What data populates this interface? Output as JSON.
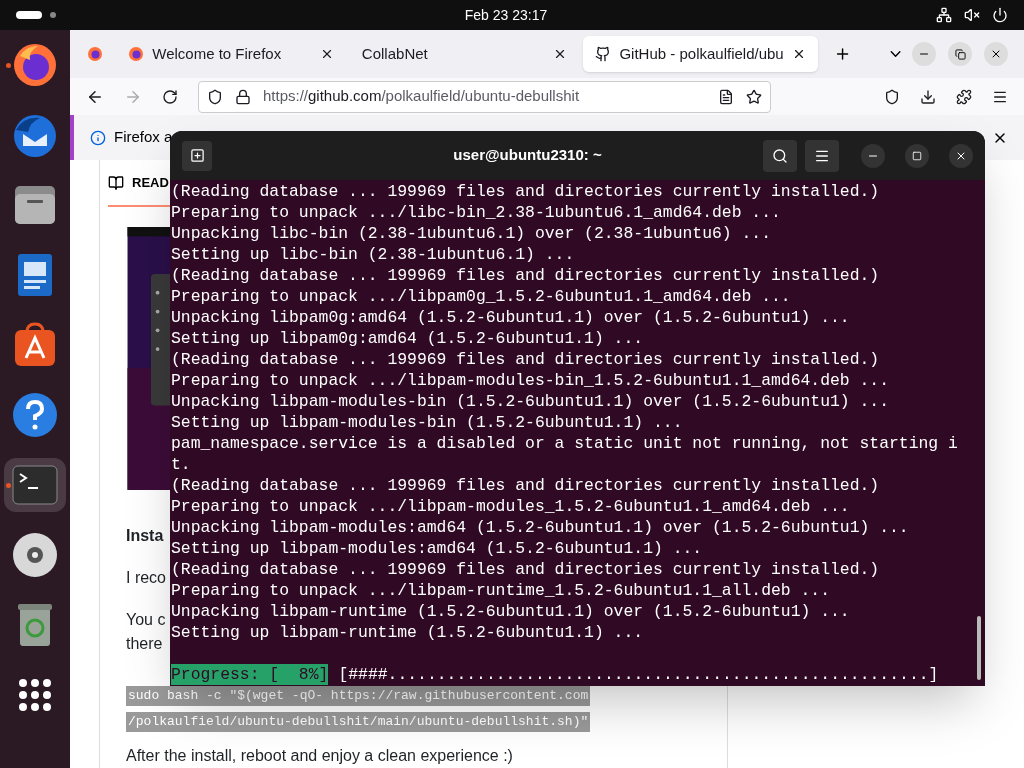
{
  "top_bar": {
    "clock": "Feb 23  23:17"
  },
  "dock": [
    {
      "kind": "firefox",
      "running": true
    },
    {
      "kind": "mail",
      "running": false
    },
    {
      "kind": "files",
      "running": false
    },
    {
      "kind": "writer",
      "running": false
    },
    {
      "kind": "store",
      "running": false
    },
    {
      "kind": "help",
      "running": false
    },
    {
      "kind": "terminal",
      "running": true,
      "selected": true
    },
    {
      "kind": "disc",
      "running": false
    },
    {
      "kind": "trash",
      "running": false
    },
    {
      "kind": "grid",
      "running": false
    }
  ],
  "browser": {
    "tabs": [
      {
        "label": "Welcome to Firefox",
        "selected": false,
        "kind": "firefox"
      },
      {
        "label": "CollabNet",
        "selected": false,
        "kind": "none"
      },
      {
        "label": "GitHub - polkaulfield/ubu",
        "selected": true,
        "kind": "github"
      }
    ],
    "url": {
      "prefix": "https://",
      "host": "github.com",
      "path": "/polkaulfield/ubuntu-debullshit"
    },
    "notice": "Firefox a",
    "readme_tab": "READ",
    "heading": "Insta",
    "paragraphs": [
      "I reco",
      "You c",
      "there"
    ],
    "code_lines": [
      "sudo bash -c \"$(wget -qO- https://raw.githubusercontent.com",
      "/polkaulfield/ubuntu-debullshit/main/ubuntu-debullshit.sh)\""
    ],
    "closing": "After the install, reboot and enjoy a clean experience :)"
  },
  "terminal": {
    "title": "user@ubuntu2310: ~",
    "lines": [
      "(Reading database ... 199969 files and directories currently installed.)",
      "Preparing to unpack .../libc-bin_2.38-1ubuntu6.1_amd64.deb ...",
      "Unpacking libc-bin (2.38-1ubuntu6.1) over (2.38-1ubuntu6) ...",
      "Setting up libc-bin (2.38-1ubuntu6.1) ...",
      "(Reading database ... 199969 files and directories currently installed.)",
      "Preparing to unpack .../libpam0g_1.5.2-6ubuntu1.1_amd64.deb ...",
      "Unpacking libpam0g:amd64 (1.5.2-6ubuntu1.1) over (1.5.2-6ubuntu1) ...",
      "Setting up libpam0g:amd64 (1.5.2-6ubuntu1.1) ...",
      "(Reading database ... 199969 files and directories currently installed.)",
      "Preparing to unpack .../libpam-modules-bin_1.5.2-6ubuntu1.1_amd64.deb ...",
      "Unpacking libpam-modules-bin (1.5.2-6ubuntu1.1) over (1.5.2-6ubuntu1) ...",
      "Setting up libpam-modules-bin (1.5.2-6ubuntu1.1) ...",
      "pam_namespace.service is a disabled or a static unit not running, not starting i",
      "t.",
      "(Reading database ... 199969 files and directories currently installed.)",
      "Preparing to unpack .../libpam-modules_1.5.2-6ubuntu1.1_amd64.deb ...",
      "Unpacking libpam-modules:amd64 (1.5.2-6ubuntu1.1) over (1.5.2-6ubuntu1) ...",
      "Setting up libpam-modules:amd64 (1.5.2-6ubuntu1.1) ...",
      "(Reading database ... 199969 files and directories currently installed.)",
      "Preparing to unpack .../libpam-runtime_1.5.2-6ubuntu1.1_all.deb ...",
      "Unpacking libpam-runtime (1.5.2-6ubuntu1.1) over (1.5.2-6ubuntu1) ...",
      "Setting up libpam-runtime (1.5.2-6ubuntu1.1) ..."
    ],
    "progress_label": "Progress: [  8%]",
    "progress_bar": "[####.......................................................]"
  }
}
